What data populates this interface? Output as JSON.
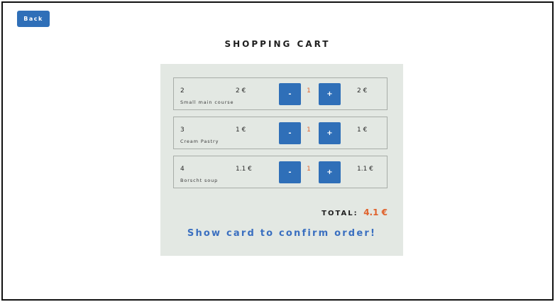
{
  "header": {
    "back_label": "Back",
    "title": "SHOPPING CART"
  },
  "cart": {
    "items": [
      {
        "id": "2",
        "name": "Small main course",
        "price": "2 €",
        "minus_label": "-",
        "quantity": "1",
        "plus_label": "+",
        "subtotal": "2 €"
      },
      {
        "id": "3",
        "name": "Cream Pastry",
        "price": "1 €",
        "minus_label": "-",
        "quantity": "1",
        "plus_label": "+",
        "subtotal": "1 €"
      },
      {
        "id": "4",
        "name": "Borscht soup",
        "price": "1.1 €",
        "minus_label": "-",
        "quantity": "1",
        "plus_label": "+",
        "subtotal": "1.1 €"
      }
    ],
    "total_label": "TOTAL:",
    "total_value": "4.1 €",
    "confirm_message": "Show card to confirm order!"
  },
  "colors": {
    "accent": "#2f6fb8",
    "highlight": "#e0622c",
    "panel": "#e3e8e3",
    "message": "#3a6fc0"
  }
}
